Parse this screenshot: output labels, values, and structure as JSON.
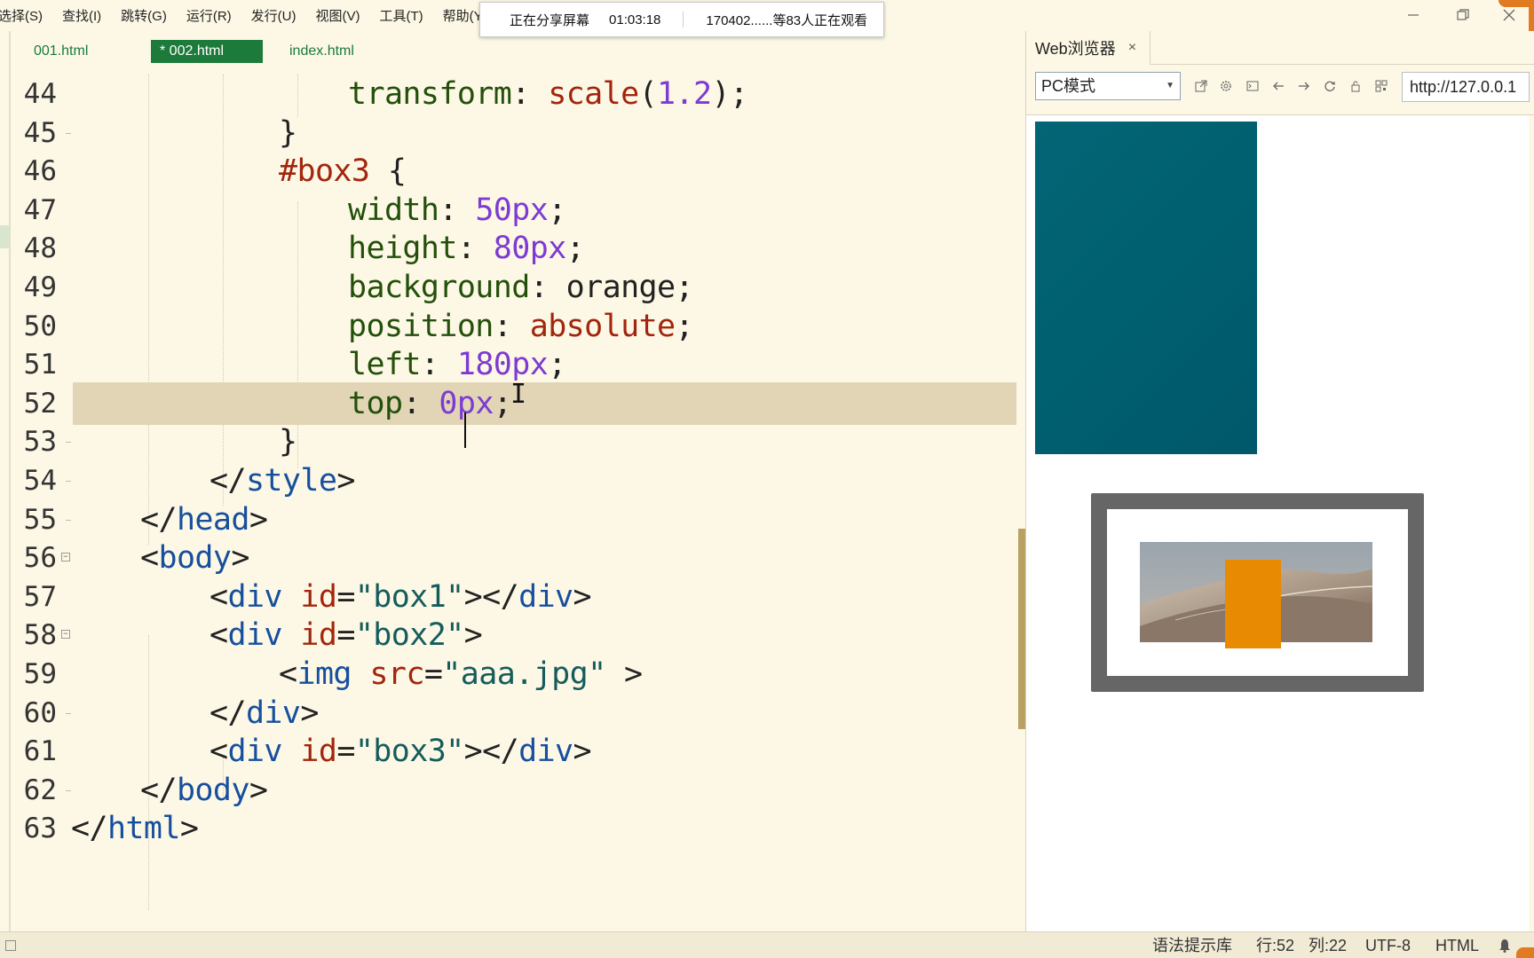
{
  "menu": {
    "items": [
      "选择(S)",
      "查找(I)",
      "跳转(G)",
      "运行(R)",
      "发行(U)",
      "视图(V)",
      "工具(T)",
      "帮助(Y"
    ]
  },
  "share_popup": {
    "status": "正在分享屏幕",
    "elapsed": "01:03:18",
    "viewers": "170402......等83人正在观看"
  },
  "editor": {
    "tabs": [
      {
        "label": "001.html",
        "active": false
      },
      {
        "label": "* 002.html",
        "active": true
      },
      {
        "label": "index.html",
        "active": false
      }
    ],
    "active_line": 52,
    "lines": [
      {
        "n": "44",
        "tokens": [
          {
            "t": "transform",
            "c": "t-prop"
          },
          {
            "t": ": ",
            "c": "t-pun"
          },
          {
            "t": "scale",
            "c": "t-val"
          },
          {
            "t": "(",
            "c": "t-pun"
          },
          {
            "t": "1.2",
            "c": "t-num"
          },
          {
            "t": ");",
            "c": "t-pun"
          }
        ]
      },
      {
        "n": "45",
        "tokens": [
          {
            "t": "}",
            "c": "t-pun"
          }
        ]
      },
      {
        "n": "46",
        "tokens": [
          {
            "t": "#box3",
            "c": "t-sel"
          },
          {
            "t": " {",
            "c": "t-pun"
          }
        ]
      },
      {
        "n": "47",
        "tokens": [
          {
            "t": "width",
            "c": "t-prop"
          },
          {
            "t": ": ",
            "c": "t-pun"
          },
          {
            "t": "50px",
            "c": "t-num"
          },
          {
            "t": ";",
            "c": "t-pun"
          }
        ]
      },
      {
        "n": "48",
        "tokens": [
          {
            "t": "height",
            "c": "t-prop"
          },
          {
            "t": ": ",
            "c": "t-pun"
          },
          {
            "t": "80px",
            "c": "t-num"
          },
          {
            "t": ";",
            "c": "t-pun"
          }
        ]
      },
      {
        "n": "49",
        "tokens": [
          {
            "t": "background",
            "c": "t-prop"
          },
          {
            "t": ": ",
            "c": "t-pun"
          },
          {
            "t": "orange",
            "c": "t-plain"
          },
          {
            "t": ";",
            "c": "t-pun"
          }
        ]
      },
      {
        "n": "50",
        "tokens": [
          {
            "t": "position",
            "c": "t-prop"
          },
          {
            "t": ": ",
            "c": "t-pun"
          },
          {
            "t": "absolute",
            "c": "t-val"
          },
          {
            "t": ";",
            "c": "t-pun"
          }
        ]
      },
      {
        "n": "51",
        "tokens": [
          {
            "t": "left",
            "c": "t-prop"
          },
          {
            "t": ": ",
            "c": "t-pun"
          },
          {
            "t": "180px",
            "c": "t-num"
          },
          {
            "t": ";",
            "c": "t-pun"
          }
        ]
      },
      {
        "n": "52",
        "tokens": [
          {
            "t": "top",
            "c": "t-prop"
          },
          {
            "t": ": ",
            "c": "t-pun"
          },
          {
            "t": "0px",
            "c": "t-num"
          },
          {
            "t": ";",
            "c": "t-pun"
          }
        ]
      },
      {
        "n": "53",
        "tokens": [
          {
            "t": "}",
            "c": "t-pun"
          }
        ]
      },
      {
        "n": "54",
        "tokens": [
          {
            "t": "</",
            "c": "t-plain"
          },
          {
            "t": "style",
            "c": "t-tag"
          },
          {
            "t": ">",
            "c": "t-plain"
          }
        ]
      },
      {
        "n": "55",
        "tokens": [
          {
            "t": "</",
            "c": "t-plain"
          },
          {
            "t": "head",
            "c": "t-tag"
          },
          {
            "t": ">",
            "c": "t-plain"
          }
        ]
      },
      {
        "n": "56",
        "tokens": [
          {
            "t": "<",
            "c": "t-plain"
          },
          {
            "t": "body",
            "c": "t-tag"
          },
          {
            "t": ">",
            "c": "t-plain"
          }
        ]
      },
      {
        "n": "57",
        "tokens": [
          {
            "t": "<",
            "c": "t-plain"
          },
          {
            "t": "div",
            "c": "t-tag"
          },
          {
            "t": " ",
            "c": "t-plain"
          },
          {
            "t": "id",
            "c": "t-attr"
          },
          {
            "t": "=",
            "c": "t-plain"
          },
          {
            "t": "\"box1\"",
            "c": "t-str"
          },
          {
            "t": "></",
            "c": "t-plain"
          },
          {
            "t": "div",
            "c": "t-tag"
          },
          {
            "t": ">",
            "c": "t-plain"
          }
        ]
      },
      {
        "n": "58",
        "tokens": [
          {
            "t": "<",
            "c": "t-plain"
          },
          {
            "t": "div",
            "c": "t-tag"
          },
          {
            "t": " ",
            "c": "t-plain"
          },
          {
            "t": "id",
            "c": "t-attr"
          },
          {
            "t": "=",
            "c": "t-plain"
          },
          {
            "t": "\"box2\"",
            "c": "t-str"
          },
          {
            "t": ">",
            "c": "t-plain"
          }
        ]
      },
      {
        "n": "59",
        "tokens": [
          {
            "t": "<",
            "c": "t-plain"
          },
          {
            "t": "img",
            "c": "t-tag"
          },
          {
            "t": " ",
            "c": "t-plain"
          },
          {
            "t": "src",
            "c": "t-attr"
          },
          {
            "t": "=",
            "c": "t-plain"
          },
          {
            "t": "\"aaa.jpg\"",
            "c": "t-str"
          },
          {
            "t": " >",
            "c": "t-plain"
          }
        ]
      },
      {
        "n": "60",
        "tokens": [
          {
            "t": "</",
            "c": "t-plain"
          },
          {
            "t": "div",
            "c": "t-tag"
          },
          {
            "t": ">",
            "c": "t-plain"
          }
        ]
      },
      {
        "n": "61",
        "tokens": [
          {
            "t": "<",
            "c": "t-plain"
          },
          {
            "t": "div",
            "c": "t-tag"
          },
          {
            "t": " ",
            "c": "t-plain"
          },
          {
            "t": "id",
            "c": "t-attr"
          },
          {
            "t": "=",
            "c": "t-plain"
          },
          {
            "t": "\"box3\"",
            "c": "t-str"
          },
          {
            "t": "></",
            "c": "t-plain"
          },
          {
            "t": "div",
            "c": "t-tag"
          },
          {
            "t": ">",
            "c": "t-plain"
          }
        ]
      },
      {
        "n": "62",
        "tokens": [
          {
            "t": "</",
            "c": "t-plain"
          },
          {
            "t": "body",
            "c": "t-tag"
          },
          {
            "t": ">",
            "c": "t-plain"
          }
        ]
      },
      {
        "n": "63",
        "tokens": [
          {
            "t": "</",
            "c": "t-plain"
          },
          {
            "t": "html",
            "c": "t-tag"
          },
          {
            "t": ">",
            "c": "t-plain"
          }
        ]
      }
    ]
  },
  "browser": {
    "tab_label": "Web浏览器",
    "tab_close": "×",
    "mode": "PC模式",
    "url": "http://127.0.0.1",
    "toolbar_icons": [
      "open-external-icon",
      "settings-icon",
      "console-icon",
      "back-icon",
      "forward-icon",
      "refresh-icon",
      "lock-icon",
      "qr-code-icon"
    ]
  },
  "statusbar": {
    "syntax": "语法提示库",
    "row": "行:52",
    "col": "列:22",
    "encoding": "UTF-8",
    "language": "HTML"
  },
  "colors": {
    "editor_bg": "#fdf8e6",
    "active_line": "#e1d5b6",
    "active_tab": "#1c7a3a",
    "box1": "#036575",
    "box3": "#e88a02",
    "box2_frame": "#666666",
    "accent": "#e07b22"
  }
}
